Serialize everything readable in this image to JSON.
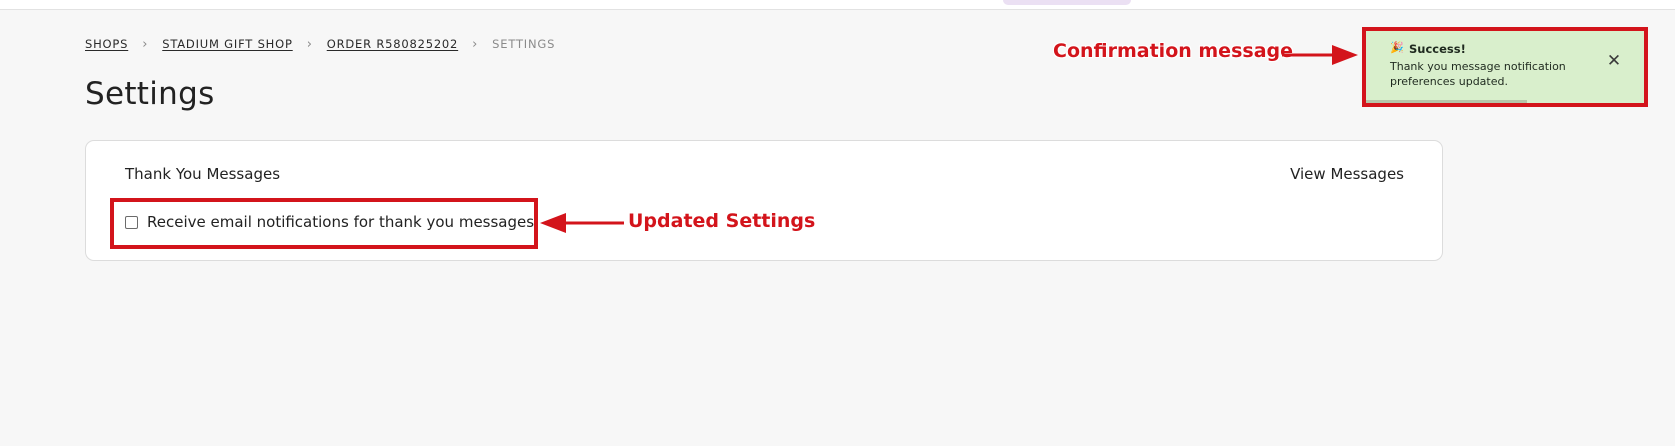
{
  "breadcrumb": {
    "items": [
      "SHOPS",
      "STADIUM GIFT SHOP",
      "ORDER R580825202"
    ],
    "current": "SETTINGS",
    "separator_icon": "chevron-right-icon"
  },
  "page": {
    "title": "Settings"
  },
  "card": {
    "title": "Thank You Messages",
    "view_messages_label": "View Messages",
    "checkbox_label": "Receive email notifications for thank you messages.",
    "checkbox_checked": false
  },
  "toast": {
    "icon": "party-popper-icon",
    "title": "Success!",
    "message": "Thank you message notification preferences updated.",
    "close_icon": "close-icon",
    "progress_remaining": 0.58
  },
  "annotations": {
    "confirmation_label": "Confirmation message",
    "settings_label": "Updated Settings",
    "color": "#d3141b"
  }
}
